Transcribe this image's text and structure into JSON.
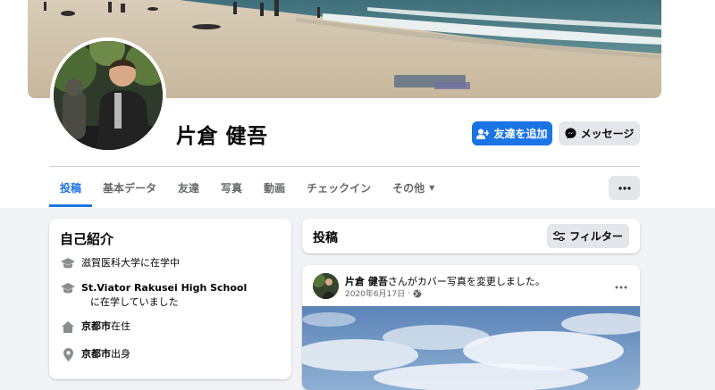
{
  "profile": {
    "name": "片倉 健吾",
    "add_friend_label": "友達を追加",
    "message_label": "メッセージ"
  },
  "tabs": [
    {
      "label": "投稿",
      "active": true
    },
    {
      "label": "基本データ"
    },
    {
      "label": "友達"
    },
    {
      "label": "写真"
    },
    {
      "label": "動画"
    },
    {
      "label": "チェックイン"
    },
    {
      "label": "その他"
    }
  ],
  "intro": {
    "title": "自己紹介",
    "items": [
      {
        "icon": "graduation-cap-icon",
        "text": "滋賀医科大学に在学中"
      },
      {
        "icon": "graduation-cap-icon",
        "text_bold": "St.Viator Rakusei High School",
        "text_rest": "に在学していました"
      },
      {
        "icon": "home-icon",
        "text_bold": "京都市",
        "text_rest": "在住"
      },
      {
        "icon": "location-pin-icon",
        "text_bold": "京都市",
        "text_rest": "出身"
      }
    ]
  },
  "posts": {
    "title": "投稿",
    "filter_label": "フィルター"
  },
  "post": {
    "author": "片倉 健吾",
    "action": "さんがカバー写真を変更しました。",
    "date": "2020年6月17日",
    "sep": "·"
  },
  "colors": {
    "accent": "#1b74e4",
    "background": "#f0f2f5",
    "button_gray": "#e4e6eb",
    "secondary_text": "#65676b"
  }
}
